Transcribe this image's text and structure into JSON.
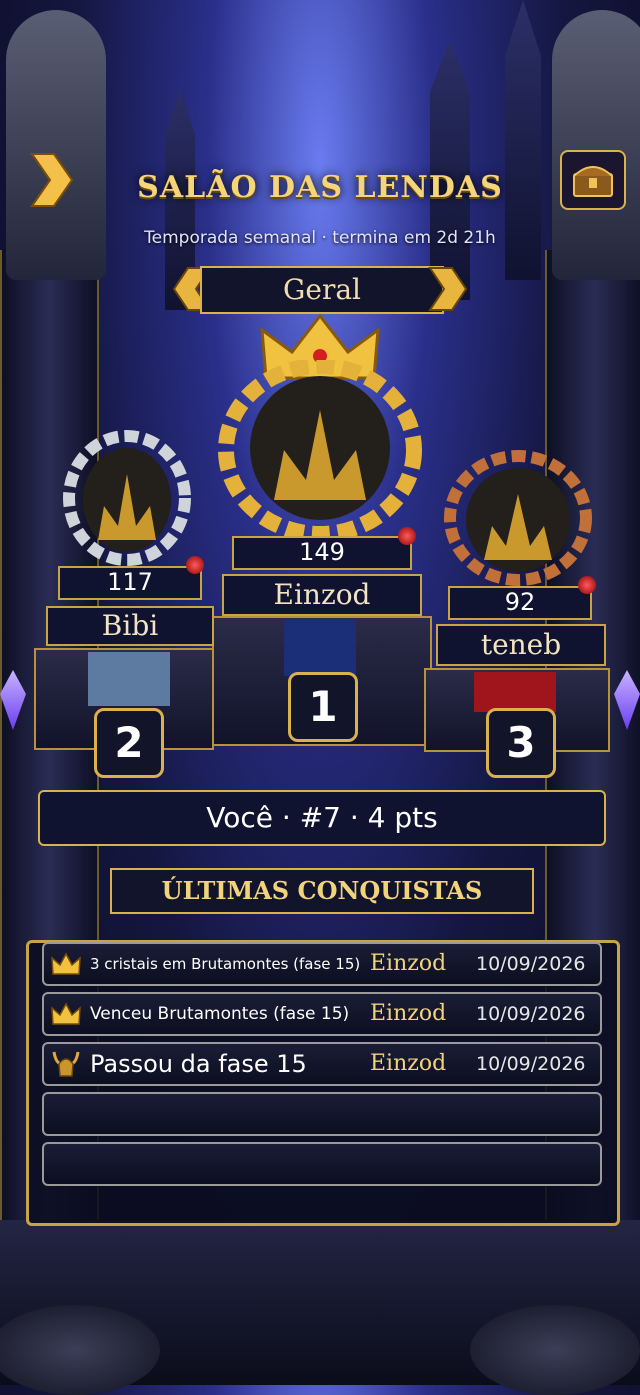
{
  "header": {
    "title": "SALÃO DAS LENDAS",
    "subtitle": "Temporada semanal · termina em 2d 21h"
  },
  "tab": {
    "label": "Geral"
  },
  "podium": [
    {
      "rank": "1",
      "name": "Einzod",
      "score": "149"
    },
    {
      "rank": "2",
      "name": "Bibi",
      "score": "117"
    },
    {
      "rank": "3",
      "name": "teneb",
      "score": "92"
    }
  ],
  "player": {
    "summary": "Você · #7 · 4 pts"
  },
  "achievements": {
    "title": "ÚLTIMAS CONQUISTAS",
    "rows": [
      {
        "icon": "crown-icon",
        "text": "3 cristais em Brutamontes (fase 15)",
        "player": "Einzod",
        "date": "10/09/2026"
      },
      {
        "icon": "crown-icon",
        "text": "Venceu Brutamontes (fase 15)",
        "player": "Einzod",
        "date": "10/09/2026"
      },
      {
        "icon": "horned-helmet-icon",
        "text": "Passou da fase 15",
        "player": "Einzod",
        "date": "10/09/2026"
      }
    ]
  },
  "colors": {
    "gold": "#d9b24b",
    "bg": "#14163f",
    "gem": "#c41414"
  }
}
